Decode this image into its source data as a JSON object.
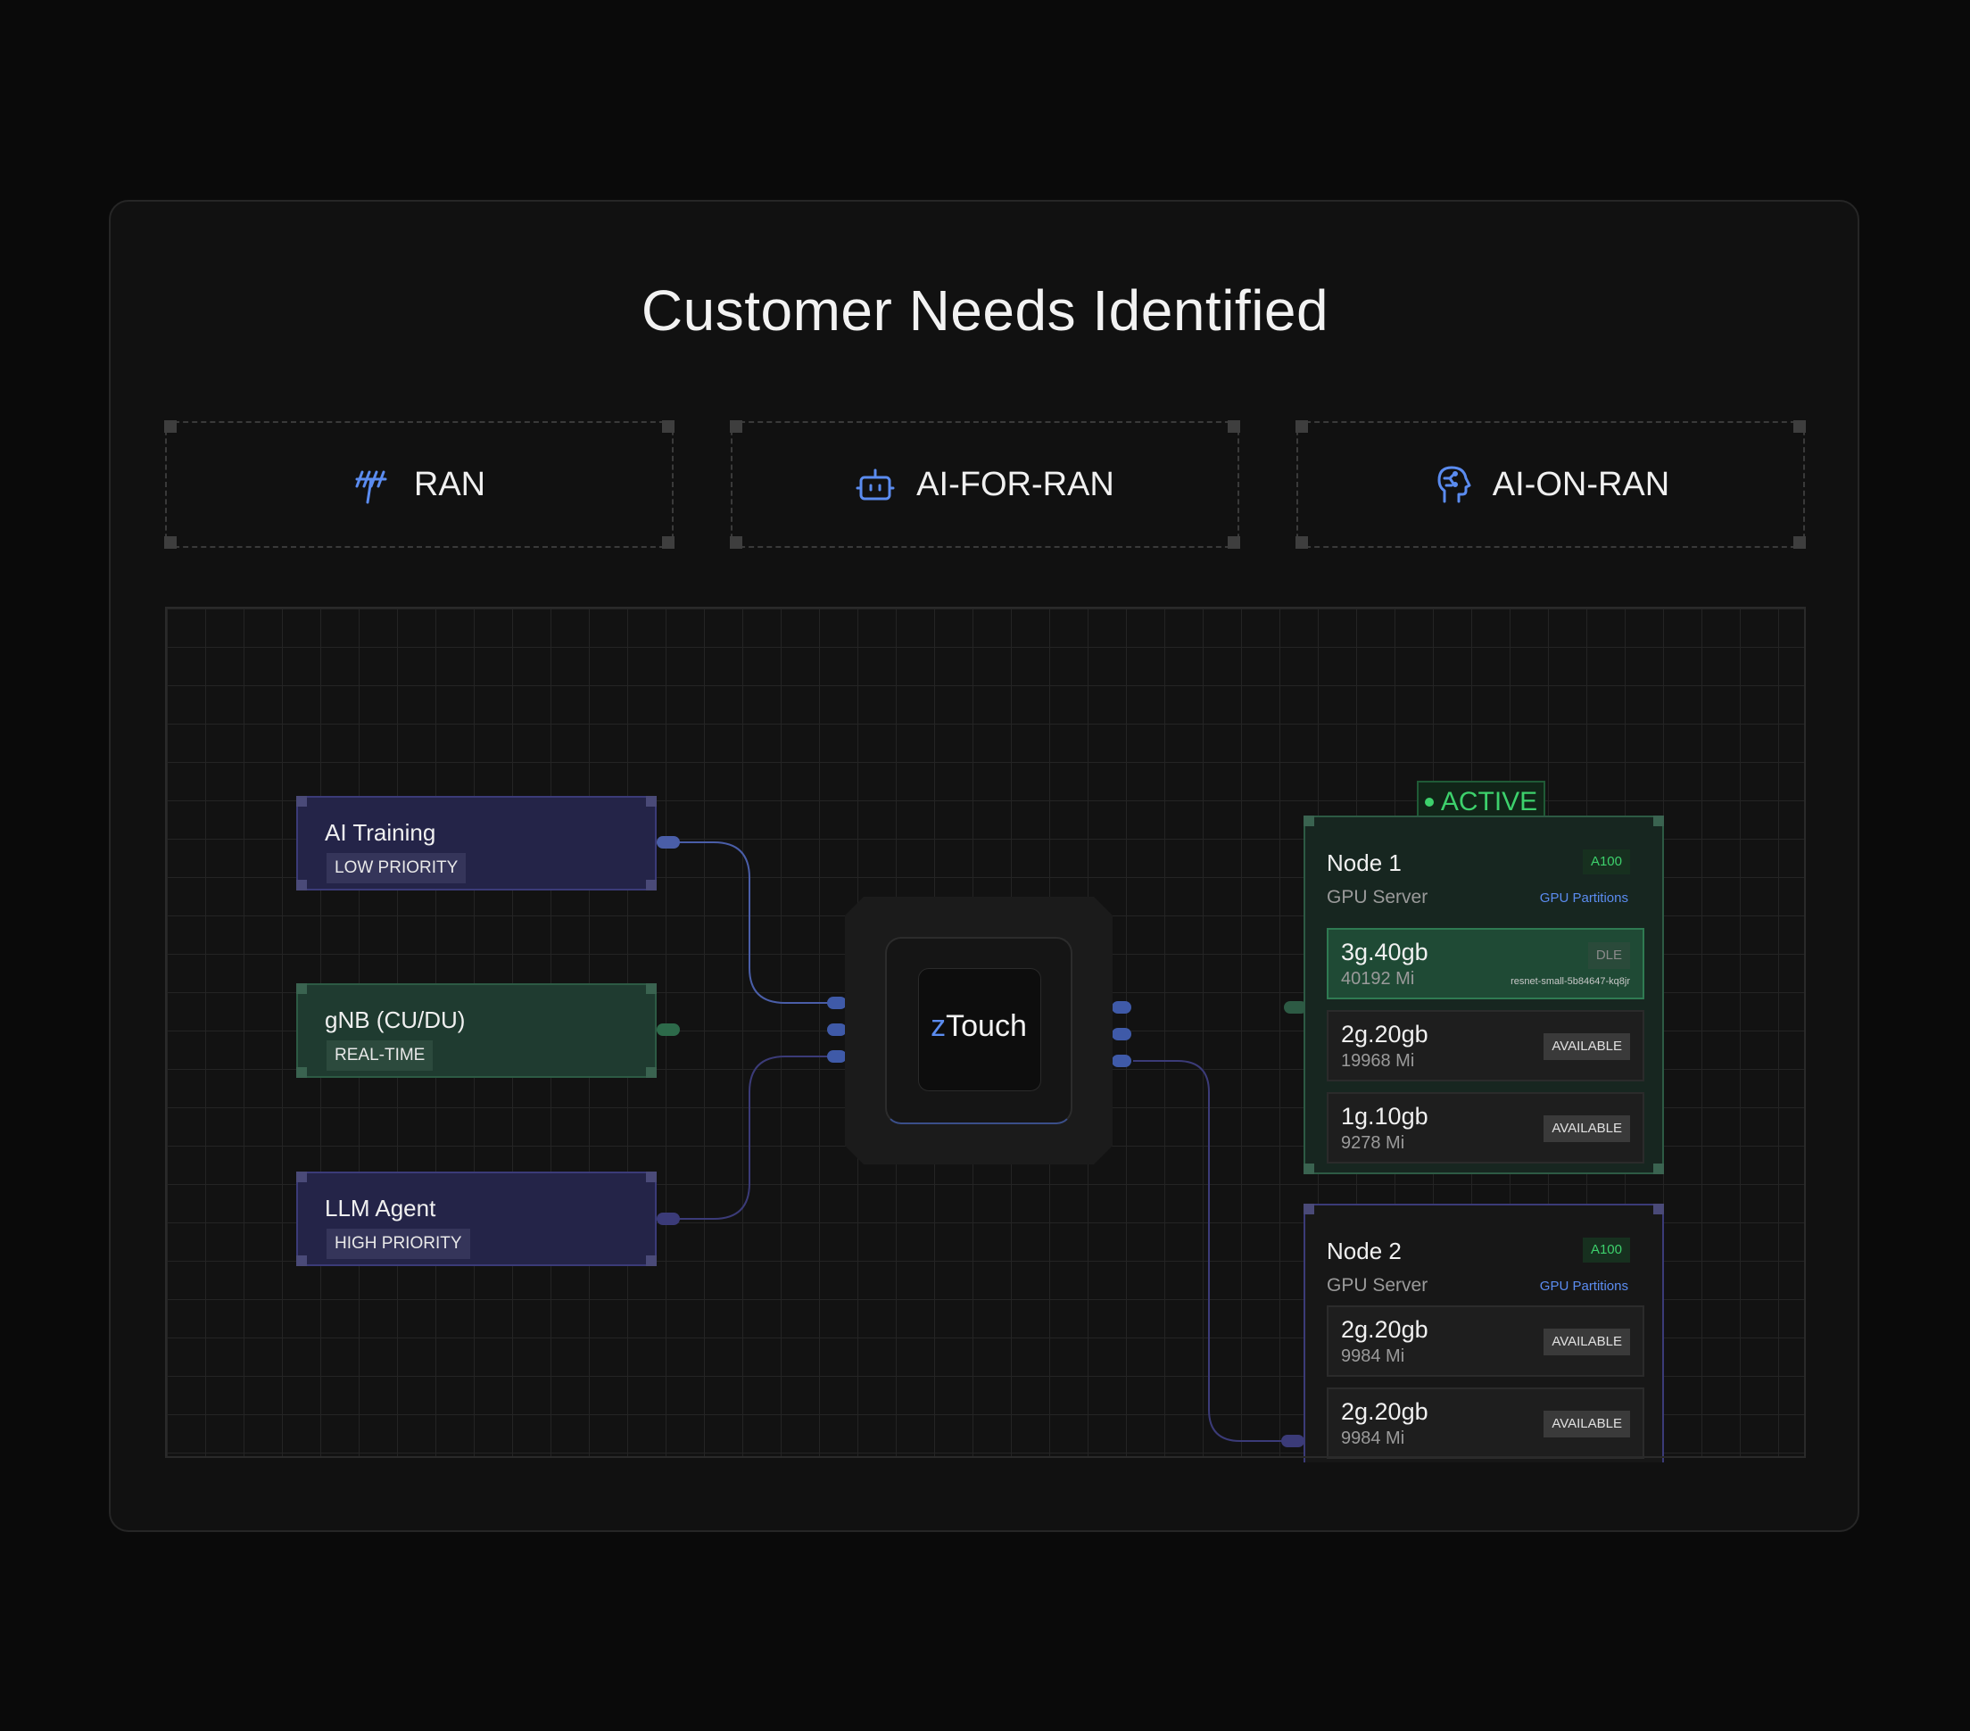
{
  "title": "Customer Needs Identified",
  "categories": [
    {
      "label": "RAN",
      "icon": "antenna-icon"
    },
    {
      "label": "AI-FOR-RAN",
      "icon": "robot-icon"
    },
    {
      "label": "AI-ON-RAN",
      "icon": "ai-head-icon"
    }
  ],
  "jobs": [
    {
      "name": "AI Training",
      "tag": "LOW PRIORITY"
    },
    {
      "name": "gNB (CU/DU)",
      "tag": "REAL-TIME"
    },
    {
      "name": "LLM Agent",
      "tag": "HIGH PRIORITY"
    }
  ],
  "orchestrator": {
    "prefix": "z",
    "rest": "Touch"
  },
  "active_badge": "ACTIVE",
  "nodes": [
    {
      "name": "Node 1",
      "subtitle": "GPU Server",
      "gpu": "A100",
      "link": "GPU Partitions",
      "partitions": [
        {
          "profile": "3g.40gb",
          "memory": "40192 Mi",
          "status": "DLE",
          "pod": "resnet-small-5b84647-kq8jr"
        },
        {
          "profile": "2g.20gb",
          "memory": "19968 Mi",
          "status": "AVAILABLE"
        },
        {
          "profile": "1g.10gb",
          "memory": "9278 Mi",
          "status": "AVAILABLE"
        }
      ]
    },
    {
      "name": "Node 2",
      "subtitle": "GPU Server",
      "gpu": "A100",
      "link": "GPU Partitions",
      "partitions": [
        {
          "profile": "2g.20gb",
          "memory": "9984 Mi",
          "status": "AVAILABLE"
        },
        {
          "profile": "2g.20gb",
          "memory": "9984 Mi",
          "status": "AVAILABLE"
        }
      ]
    }
  ],
  "colors": {
    "accent_blue": "#5b8cf0",
    "active_green": "#3dd16c",
    "job_purple": "#242448",
    "job_green": "#1f3b30"
  }
}
